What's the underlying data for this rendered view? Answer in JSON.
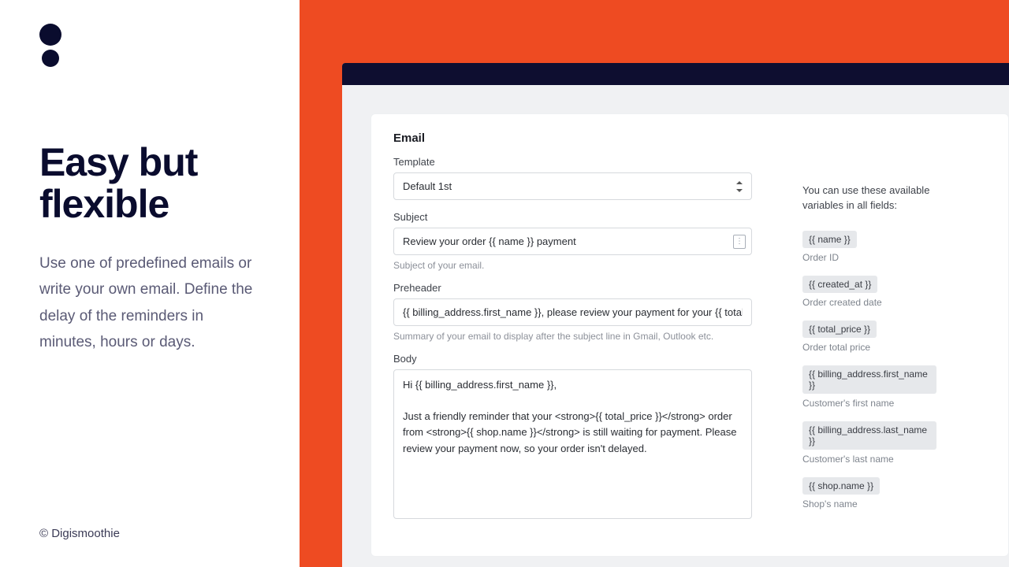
{
  "left": {
    "headline": "Easy but flexible",
    "subcopy": "Use one of predefined emails or write your own email. Define the delay of the reminders in minutes, hours or days.",
    "credit": "© Digismoothie"
  },
  "email": {
    "title": "Email",
    "template_label": "Template",
    "template_value": "Default 1st",
    "subject_label": "Subject",
    "subject_value": "Review your order {{ name }} payment",
    "subject_hint": "Subject of your email.",
    "preheader_label": "Preheader",
    "preheader_value": "{{ billing_address.first_name }}, please review your payment for your {{ total_price }} order",
    "preheader_hint": "Summary of your email to display after the subject line in Gmail, Outlook etc.",
    "body_label": "Body",
    "body_value": "Hi {{ billing_address.first_name }},\n\nJust a friendly reminder that your <strong>{{ total_price }}</strong> order from <strong>{{ shop.name }}</strong> is still waiting for payment. Please review your payment now, so your order isn't delayed."
  },
  "vars": {
    "intro": "You can use these available variables in all fields:",
    "items": [
      {
        "token": "{{ name }}",
        "desc": "Order ID"
      },
      {
        "token": "{{ created_at }}",
        "desc": "Order created date"
      },
      {
        "token": "{{ total_price }}",
        "desc": "Order total price"
      },
      {
        "token": "{{ billing_address.first_name }}",
        "desc": "Customer's first name"
      },
      {
        "token": "{{ billing_address.last_name }}",
        "desc": "Customer's last name"
      },
      {
        "token": "{{ shop.name }}",
        "desc": "Shop's name"
      }
    ]
  }
}
